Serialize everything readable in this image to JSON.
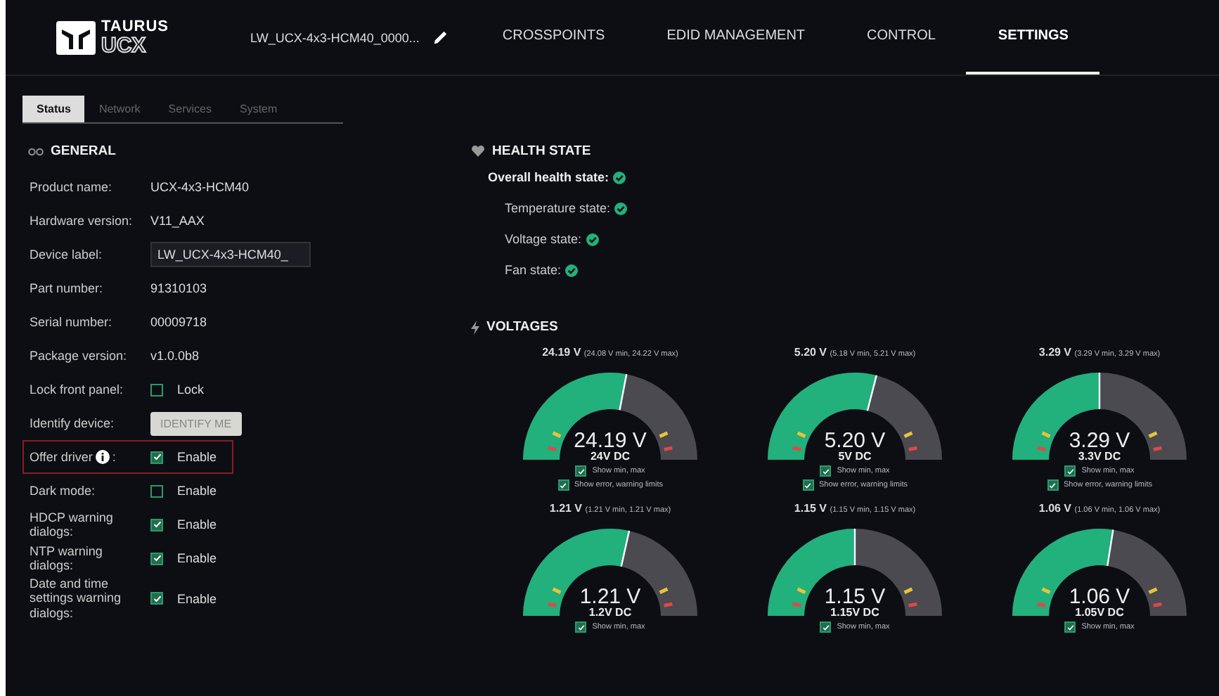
{
  "header": {
    "logo": {
      "line_1": "TAURUS",
      "line_2": "UCX"
    },
    "device_name": "LW_UCX-4x3-HCM40_0000...",
    "nav": [
      {
        "label": "CROSSPOINTS",
        "selected": false
      },
      {
        "label": "EDID MANAGEMENT",
        "selected": false
      },
      {
        "label": "CONTROL",
        "selected": false
      },
      {
        "label": "SETTINGS",
        "selected": true
      }
    ]
  },
  "sub_tabs": [
    {
      "label": "Status",
      "selected": true
    },
    {
      "label": "Network",
      "selected": false
    },
    {
      "label": "Services",
      "selected": false
    },
    {
      "label": "System",
      "selected": false
    }
  ],
  "general": {
    "title": "GENERAL",
    "rows": [
      {
        "kind": "text",
        "label": "Product name:",
        "value": "UCX-4x3-HCM40"
      },
      {
        "kind": "text",
        "label": "Hardware version:",
        "value": "V11_AAX"
      },
      {
        "kind": "input",
        "label": "Device label:",
        "value": "LW_UCX-4x3-HCM40_"
      },
      {
        "kind": "text",
        "label": "Part number:",
        "value": "91310103"
      },
      {
        "kind": "text",
        "label": "Serial number:",
        "value": "00009718"
      },
      {
        "kind": "text",
        "label": "Package version:",
        "value": "v1.0.0b8"
      },
      {
        "kind": "checkbox",
        "label": "Lock front panel:",
        "value": "Lock",
        "checked": false
      },
      {
        "kind": "button",
        "label": "Identify device:",
        "value": "IDENTIFY ME"
      },
      {
        "kind": "checkbox",
        "label": "Offer driver",
        "suffix": ":",
        "info": true,
        "highlighted": true,
        "value": "Enable",
        "checked": true
      },
      {
        "kind": "checkbox",
        "label": "Dark mode:",
        "value": "Enable",
        "checked": false
      },
      {
        "kind": "checkbox",
        "label": "HDCP warning dialogs:",
        "value": "Enable",
        "checked": true
      },
      {
        "kind": "checkbox",
        "label": "NTP warning dialogs:",
        "value": "Enable",
        "checked": true
      },
      {
        "kind": "checkbox",
        "label": "Date and time settings warning dialogs:",
        "value": "Enable",
        "checked": true
      }
    ]
  },
  "health": {
    "title": "HEALTH STATE",
    "items": [
      {
        "label": "Overall health state:",
        "ok": true,
        "children": [
          {
            "label": "Temperature state:",
            "ok": true
          },
          {
            "label": "Voltage state:",
            "ok": true
          },
          {
            "label": "Fan state:",
            "ok": true
          }
        ]
      }
    ]
  },
  "voltages": {
    "title": "VOLTAGES",
    "gauges": [
      {
        "reading": "24.19 V",
        "range": "(24.08 V min, 24.22 V max)",
        "value": "24.19 V",
        "type": "24V DC",
        "level": 0.56,
        "options": [
          {
            "label": "Show min, max",
            "checked": true
          },
          {
            "label": "Show error, warning limits",
            "checked": true
          }
        ]
      },
      {
        "reading": "5.20 V",
        "range": "(5.18 V min, 5.21 V max)",
        "value": "5.20 V",
        "type": "5V DC",
        "level": 0.58,
        "options": [
          {
            "label": "Show min, max",
            "checked": true
          },
          {
            "label": "Show error, warning limits",
            "checked": true
          }
        ]
      },
      {
        "reading": "3.29 V",
        "range": "(3.29 V min, 3.29 V max)",
        "value": "3.29 V",
        "type": "3.3V DC",
        "level": 0.5,
        "options": [
          {
            "label": "Show min, max",
            "checked": true
          },
          {
            "label": "Show error, warning limits",
            "checked": true
          }
        ]
      },
      {
        "reading": "1.21 V",
        "range": "(1.21 V min, 1.21 V max)",
        "value": "1.21 V",
        "type": "1.2V DC",
        "level": 0.57,
        "options": [
          {
            "label": "Show min, max",
            "checked": true
          }
        ]
      },
      {
        "reading": "1.15 V",
        "range": "(1.15 V min, 1.15 V max)",
        "value": "1.15 V",
        "type": "1.15V DC",
        "level": 0.5,
        "options": [
          {
            "label": "Show min, max",
            "checked": true
          }
        ]
      },
      {
        "reading": "1.06 V",
        "range": "(1.06 V min, 1.06 V max)",
        "value": "1.06 V",
        "type": "1.05V DC",
        "level": 0.55,
        "options": [
          {
            "label": "Show min, max",
            "checked": true
          }
        ]
      }
    ]
  }
}
